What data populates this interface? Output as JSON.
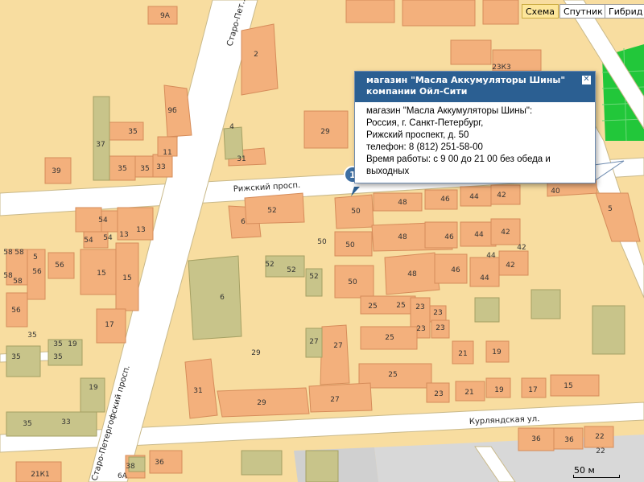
{
  "map_type_buttons": [
    {
      "label": "Схема",
      "active": true
    },
    {
      "label": "Спутник",
      "active": false
    },
    {
      "label": "Гибрид",
      "active": false
    }
  ],
  "popup": {
    "title_line1": "магазин \"Масла Аккумуляторы Шины\"",
    "title_line2": "компании Ойл-Сити",
    "body": [
      "магазин \"Масла Аккумуляторы Шины\":",
      "Россия, г. Санкт-Петербург,",
      "Рижский проспект, д. 50",
      "телефон: 8 (812) 251-58-00",
      "Время работы: с 9 00 до 21 00 без обеда и",
      "выходных"
    ],
    "close_icon": "close-icon"
  },
  "marker": {
    "label": "1"
  },
  "streets": {
    "rizhsky": "Рижский просп.",
    "kurlyandskaya": "Курляндская ул.",
    "staro_peterhof": "Старо-Петергофский просп.",
    "staro_peterhof_top": "Старо-Пет..."
  },
  "scale": {
    "label": "50 м"
  },
  "building_numbers": [
    "9А",
    "2",
    "9б",
    "35",
    "37",
    "11",
    "35",
    "33",
    "39",
    "31",
    "29",
    "4",
    "23К3",
    "48",
    "46",
    "44",
    "42",
    "40",
    "5",
    "54",
    "54",
    "13",
    "15",
    "6",
    "52",
    "50",
    "50",
    "48",
    "46",
    "44",
    "42",
    "42",
    "44",
    "42",
    "58",
    "58",
    "58",
    "56",
    "56",
    "15",
    "15",
    "52",
    "52",
    "50",
    "48",
    "46",
    "44",
    "6",
    "56",
    "17",
    "25",
    "25",
    "23",
    "23",
    "23",
    "35",
    "35",
    "19",
    "27",
    "29",
    "27",
    "25",
    "21",
    "19",
    "35",
    "19",
    "25",
    "31",
    "29",
    "27",
    "23",
    "21",
    "19",
    "17",
    "15",
    "35",
    "33",
    "36",
    "36",
    "22",
    "22",
    "21К1",
    "6А",
    "36"
  ]
}
